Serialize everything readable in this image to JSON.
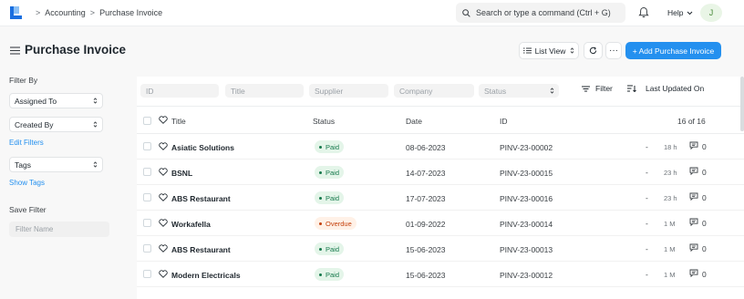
{
  "navbar": {
    "breadcrumbs": [
      "Accounting",
      "Purchase Invoice"
    ],
    "search_placeholder": "Search or type a command (Ctrl + G)",
    "help_label": "Help",
    "avatar_initial": "J"
  },
  "page": {
    "title": "Purchase Invoice",
    "list_view_label": "List View",
    "more_label": "···",
    "add_button_label": "+ Add Purchase Invoice",
    "accent_color": "#2490ef"
  },
  "sidebar": {
    "filter_by_label": "Filter By",
    "assigned_to": "Assigned To",
    "created_by": "Created By",
    "edit_filters": "Edit Filters",
    "tags": "Tags",
    "show_tags": "Show Tags",
    "save_filter_label": "Save Filter",
    "filter_name_placeholder": "Filter Name"
  },
  "filters": {
    "id": "ID",
    "title": "Title",
    "supplier": "Supplier",
    "company": "Company",
    "status": "Status",
    "filter_button": "Filter",
    "sort_label": "Last Updated On"
  },
  "table": {
    "columns": [
      "Title",
      "Status",
      "Date",
      "ID"
    ],
    "count": "16 of 16",
    "rows": [
      {
        "title": "Asiatic Solutions",
        "status": "Paid",
        "date": "08-06-2023",
        "id": "PINV-23-00002",
        "dash": "-",
        "ago": "18 h",
        "comments": "0"
      },
      {
        "title": "BSNL",
        "status": "Paid",
        "date": "14-07-2023",
        "id": "PINV-23-00015",
        "dash": "-",
        "ago": "23 h",
        "comments": "0"
      },
      {
        "title": "ABS Restaurant",
        "status": "Paid",
        "date": "17-07-2023",
        "id": "PINV-23-00016",
        "dash": "-",
        "ago": "23 h",
        "comments": "0"
      },
      {
        "title": "Workafella",
        "status": "Overdue",
        "date": "01-09-2022",
        "id": "PINV-23-00014",
        "dash": "-",
        "ago": "1 M",
        "comments": "0"
      },
      {
        "title": "ABS Restaurant",
        "status": "Paid",
        "date": "15-06-2023",
        "id": "PINV-23-00013",
        "dash": "-",
        "ago": "1 M",
        "comments": "0"
      },
      {
        "title": "Modern Electricals",
        "status": "Paid",
        "date": "15-06-2023",
        "id": "PINV-23-00012",
        "dash": "-",
        "ago": "1 M",
        "comments": "0"
      }
    ]
  }
}
